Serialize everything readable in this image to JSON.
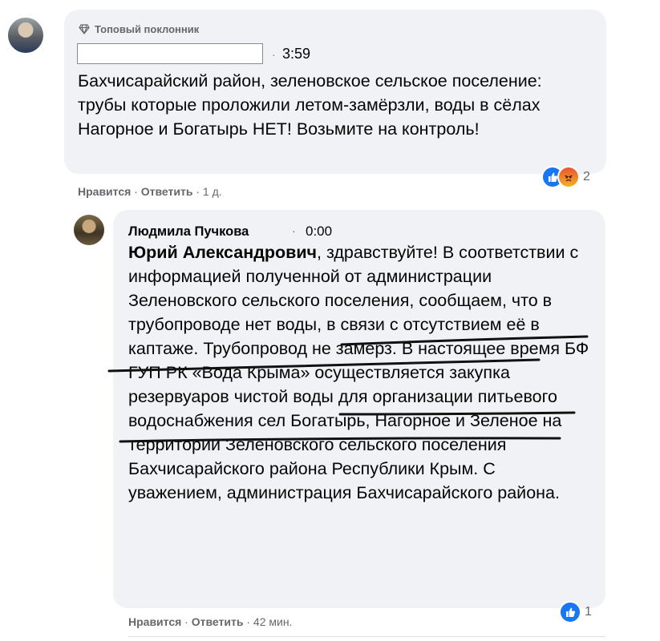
{
  "comment1": {
    "badge": "Топовый поклонник",
    "time": "3:59",
    "text": "Бахчисарайский район, зеленовское сельское поселение: трубы которые проложили летом-замёрзли, воды в сёлах Нагорное и Богатырь НЕТ! Возьмите на контроль!",
    "actions": {
      "like": "Нравится",
      "sep1": " · ",
      "reply": "Ответить",
      "sep2": " · ",
      "age": "1 д."
    },
    "reaction_count": "2"
  },
  "comment2": {
    "author": "Людмила Пучкова",
    "separator": "·",
    "time": "0:00",
    "addressee": "Юрий Александрович",
    "text": ", здравствуйте! В соответствии с информацией полученной от администрации Зеленовского сельского поселения, сообщаем, что в трубопроводе нет воды, в связи с отсутствием её в каптаже. Трубопровод не замерз. В настоящее время БФ ГУП РК «Вода Крыма» осуществляется закупка резервуаров чистой воды для организации питьевого водоснабжения сел Богатырь, Нагорное и Зеленое на территории Зеленовского сельского поселения Бахчисарайского района Республики Крым. С уважением, администрация Бахчисарайского района.",
    "actions": {
      "like": "Нравится",
      "sep1": " · ",
      "reply": "Ответить",
      "sep2": " · ",
      "age": "42 мин."
    },
    "reaction_count": "1"
  },
  "colors": {
    "bubble": "#f0f2f5",
    "secondary_text": "#65676b",
    "like_blue": "#1877f2",
    "marker_red": "#e0533a"
  }
}
